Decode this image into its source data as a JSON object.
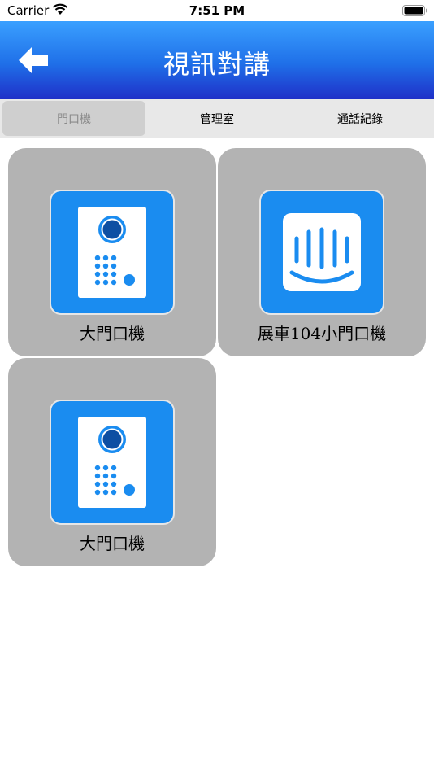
{
  "status_bar": {
    "carrier": "Carrier",
    "time": "7:51 PM"
  },
  "nav": {
    "title": "視訊對講",
    "back_icon": "back-arrow-icon"
  },
  "tabs": [
    {
      "label": "門口機",
      "selected": true
    },
    {
      "label": "管理室",
      "selected": false
    },
    {
      "label": "通話紀錄",
      "selected": false
    }
  ],
  "devices": [
    {
      "label": "大門口機",
      "icon": "door-intercom-icon"
    },
    {
      "label": "展車104小門口機",
      "icon": "smile-intercom-icon"
    },
    {
      "label": "大門口機",
      "icon": "door-intercom-icon"
    }
  ],
  "colors": {
    "nav_top": "#3aa0ff",
    "nav_bottom": "#1f2fc8",
    "card_bg": "#b3b3b3",
    "icon_bg": "#1a8cf0"
  }
}
